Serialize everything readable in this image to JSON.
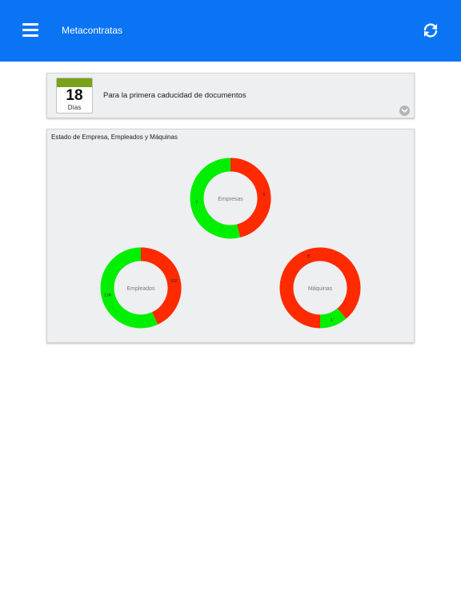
{
  "header": {
    "title": "Metacontratas",
    "bg_color": "#0a74f5"
  },
  "expiry_card": {
    "days_value": "18",
    "days_unit": "Días",
    "description": "Para la primera caducidad de documentos",
    "calendar_header_color": "#78a21a"
  },
  "status_card": {
    "title": "Estado de Empresa, Empleados y Máquinas"
  },
  "chart_data": [
    {
      "type": "pie",
      "center_label": "Empresas",
      "slices": [
        {
          "label": "7",
          "value": 7,
          "color": "#00ee00"
        },
        {
          "label": "6",
          "value": 6,
          "color": "#ff2a00"
        }
      ]
    },
    {
      "type": "pie",
      "center_label": "Empleados",
      "slices": [
        {
          "label": "174",
          "value": 174,
          "color": "#00ee00"
        },
        {
          "label": "132",
          "value": 132,
          "color": "#ff2a00"
        }
      ]
    },
    {
      "type": "pie",
      "center_label": "Máquinas",
      "slices": [
        {
          "label": "1",
          "value": 1,
          "color": "#00ee00"
        },
        {
          "label": "8",
          "value": 8,
          "color": "#ff2a00"
        }
      ]
    }
  ]
}
